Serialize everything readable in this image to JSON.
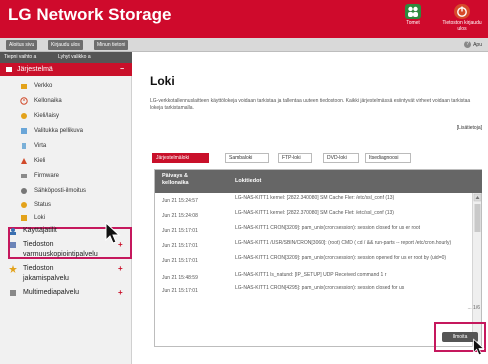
{
  "header": {
    "title": "LG Network Storage",
    "users_label": "Tomet",
    "logout_label": "Tietoston kirjaudu ulos"
  },
  "toolbar": {
    "home_label": "Aloitus sivu",
    "logout_label": "Kirjaudu ulos",
    "my_settings_label": "Minun tietoni",
    "help_label": "Apu"
  },
  "sidebar": {
    "top_left": "Tiepni vaihto a",
    "top_right": "Lyhyt valikko a",
    "section_title": "Järjestelmä",
    "section_toggle": "−",
    "items": [
      {
        "label": "Verkko",
        "icon": "network-icon"
      },
      {
        "label": "Kellonaika",
        "icon": "clock-icon"
      },
      {
        "label": "Kieli/laisy",
        "icon": "language-icon"
      },
      {
        "label": "Valitukka pellikuva",
        "icon": "image-icon"
      },
      {
        "label": "Virta",
        "icon": "power-icon"
      },
      {
        "label": "Kieli",
        "icon": "language-icon"
      },
      {
        "label": "Firmware",
        "icon": "firmware-icon"
      },
      {
        "label": "Sähköposti-ilmoitus",
        "icon": "email-icon"
      },
      {
        "label": "Status",
        "icon": "status-icon"
      },
      {
        "label": "Loki",
        "icon": "log-icon"
      }
    ],
    "groups": [
      {
        "label": "Käyttäjätilit",
        "icon": "users-icon"
      },
      {
        "label": "Tiedoston varmuuskopiointipalvelu",
        "line1": "Tiedoston",
        "line2": "varmuuskopiointipalvelu",
        "icon": "backup-icon"
      },
      {
        "label": "Tiedoston jakamispalvelu",
        "line1": "Tiedoston",
        "line2": "jakamispalvelu",
        "icon": "share-icon"
      },
      {
        "label": "Multimediapalvelu",
        "icon": "multimedia-icon"
      }
    ],
    "plus": "+"
  },
  "main": {
    "title": "Loki",
    "intro": "LG-verkkotallennuslaitteen käyttölokeja voidaan tarkistaa ja tallentaa uuteen tiedostoon. Kaikki järjestelmässä esiintyvät virheet voidaan tarkistaa lokeja tarkistamalla.",
    "details_link": "[Lisätietoja]",
    "tabs": [
      "Järjestelmäloki",
      "Sambaloki",
      "FTP-loki",
      "DVD-loki",
      "Itsediagnoosi"
    ],
    "log_headers": {
      "time_line1": "Päivays &",
      "time_line2": "kellonaika",
      "entry": "Lokitiedot"
    },
    "log_rows": [
      {
        "time": "Jun 21 15:24:57",
        "entry": "LG-NAS-KITT1 kernel: [2822.340080] SM Cache Fler: /etc/ssl_conf (13)"
      },
      {
        "time": "Jun 21 15:24:08",
        "entry": "LG-NAS-KITT1 kernel: [2822.370080] SM Cache Flet: /etc/ssl_conf (13)"
      },
      {
        "time": "Jun 21 15:17:01",
        "entry": "LG-NAS-KITT1 CRON[3209]: pam_unix(cron:session): session closed for us er root"
      },
      {
        "time": "Jun 21 15:17:01",
        "entry": "LG-NAS-KITT1 /USR/SBIN/CRON[3060]: (root) CMD ( cd / && run-parts -- report /etc/cron.hourly)"
      },
      {
        "time": "Jun 21 15:17:01",
        "entry": "LG-NAS-KITT1 CRON[3209]: pam_unix(cron:session): session opened for us er root by (uid=0)"
      },
      {
        "time": "Jun 21 15:48:59",
        "entry": "LG-NAS-KITT1 ls_natund: [IP_SETUP] UDP Received command 1 r"
      },
      {
        "time": "Jun 21 15:17:01",
        "entry": "LG-NAS-KITT1 CRON[4295]: pam_unix(cron:session): session closed for us"
      }
    ],
    "pager": "... 1/6"
  },
  "footer": {
    "cancel_label": "Ilmoita"
  }
}
